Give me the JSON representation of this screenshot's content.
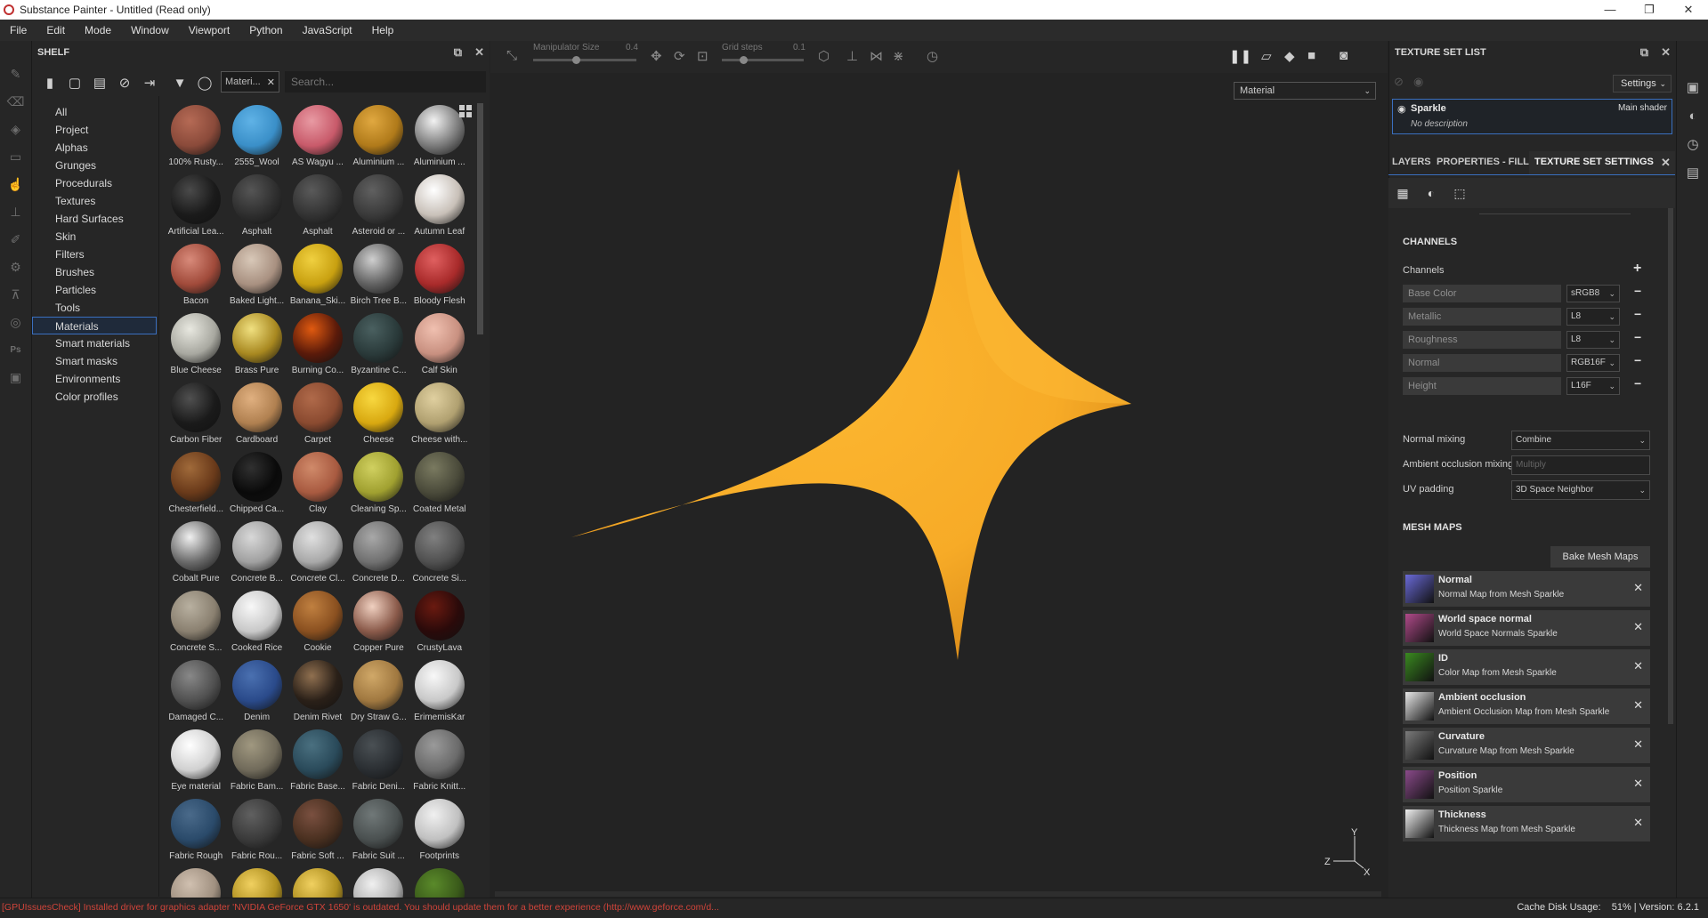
{
  "window": {
    "title": "Substance Painter - Untitled (Read only)",
    "controls": [
      "—",
      "❐",
      "✕"
    ]
  },
  "menu": [
    "File",
    "Edit",
    "Mode",
    "Window",
    "Viewport",
    "Python",
    "JavaScript",
    "Help"
  ],
  "shelf": {
    "title": "SHELF",
    "filter_chip": "Materi...",
    "search_placeholder": "Search...",
    "categories": [
      "All",
      "Project",
      "Alphas",
      "Grunges",
      "Procedurals",
      "Textures",
      "Hard Surfaces",
      "Skin",
      "Filters",
      "Brushes",
      "Particles",
      "Tools",
      "Materials",
      "Smart materials",
      "Smart masks",
      "Environments",
      "Color profiles"
    ],
    "selected_category": "Materials",
    "materials": [
      {
        "name": "100% Rusty...",
        "color": "#8a4a3a",
        "hi": "#b56a55"
      },
      {
        "name": "2555_Wool",
        "color": "#3a8fc8",
        "hi": "#5fb2e6"
      },
      {
        "name": "AS Wagyu ...",
        "color": "#c85a6a",
        "hi": "#e89aa3"
      },
      {
        "name": "Aluminium ...",
        "color": "#b07a1a",
        "hi": "#e0a840"
      },
      {
        "name": "Aluminium ...",
        "color": "#7a7a7a",
        "hi": "#f2f2f2"
      },
      {
        "name": "Artificial Lea...",
        "color": "#1a1a1a",
        "hi": "#4a4a4a"
      },
      {
        "name": "Asphalt",
        "color": "#2e2e2e",
        "hi": "#555555"
      },
      {
        "name": "Asphalt",
        "color": "#333333",
        "hi": "#5a5a5a"
      },
      {
        "name": "Asteroid or ...",
        "color": "#3a3a3a",
        "hi": "#606060"
      },
      {
        "name": "Autumn Leaf",
        "color": "#c8c0b8",
        "hi": "#ffffff"
      },
      {
        "name": "Bacon",
        "color": "#a04a3a",
        "hi": "#d88a7a"
      },
      {
        "name": "Baked Light...",
        "color": "#a89080",
        "hi": "#d8c8b8"
      },
      {
        "name": "Banana_Ski...",
        "color": "#c8a010",
        "hi": "#f0d040"
      },
      {
        "name": "Birch Tree B...",
        "color": "#606060",
        "hi": "#cfcfcf"
      },
      {
        "name": "Bloody Flesh",
        "color": "#a82a2a",
        "hi": "#e06060"
      },
      {
        "name": "Blue Cheese",
        "color": "#a8a8a0",
        "hi": "#e8e8e0"
      },
      {
        "name": "Brass Pure",
        "color": "#a88820",
        "hi": "#f0e080"
      },
      {
        "name": "Burning Co...",
        "color": "#5a1a0a",
        "hi": "#e05a10"
      },
      {
        "name": "Byzantine C...",
        "color": "#2a3a3a",
        "hi": "#4a6060"
      },
      {
        "name": "Calf Skin",
        "color": "#c89080",
        "hi": "#f0c0b0"
      },
      {
        "name": "Carbon Fiber",
        "color": "#1a1a1a",
        "hi": "#505050"
      },
      {
        "name": "Cardboard",
        "color": "#b08050",
        "hi": "#e0b080"
      },
      {
        "name": "Carpet",
        "color": "#8a4a30",
        "hi": "#b06a4a"
      },
      {
        "name": "Cheese",
        "color": "#d8a810",
        "hi": "#f8d840"
      },
      {
        "name": "Cheese with...",
        "color": "#b0a070",
        "hi": "#e0d0a0"
      },
      {
        "name": "Chesterfield...",
        "color": "#6a3a1a",
        "hi": "#a06a3a"
      },
      {
        "name": "Chipped Ca...",
        "color": "#0a0a0a",
        "hi": "#303030"
      },
      {
        "name": "Clay",
        "color": "#a85a40",
        "hi": "#d08a6a"
      },
      {
        "name": "Cleaning Sp...",
        "color": "#a0a030",
        "hi": "#d0d060"
      },
      {
        "name": "Coated Metal",
        "color": "#4a4a3a",
        "hi": "#7a7a60"
      },
      {
        "name": "Cobalt Pure",
        "color": "#6a6a6a",
        "hi": "#f0f0f0"
      },
      {
        "name": "Concrete B...",
        "color": "#a0a0a0",
        "hi": "#d8d8d8"
      },
      {
        "name": "Concrete Cl...",
        "color": "#a8a8a8",
        "hi": "#e0e0e0"
      },
      {
        "name": "Concrete D...",
        "color": "#707070",
        "hi": "#a8a8a8"
      },
      {
        "name": "Concrete Si...",
        "color": "#505050",
        "hi": "#808080"
      },
      {
        "name": "Concrete S...",
        "color": "#8a8070",
        "hi": "#b8b0a0"
      },
      {
        "name": "Cooked Rice",
        "color": "#c8c8c8",
        "hi": "#f8f8f8"
      },
      {
        "name": "Cookie",
        "color": "#8a5020",
        "hi": "#c08040"
      },
      {
        "name": "Copper Pure",
        "color": "#8a5a4a",
        "hi": "#f0d0c0"
      },
      {
        "name": "CrustyLava",
        "color": "#2a0a0a",
        "hi": "#6a1a10"
      },
      {
        "name": "Damaged C...",
        "color": "#505050",
        "hi": "#888888"
      },
      {
        "name": "Denim",
        "color": "#2a4a8a",
        "hi": "#4a70b0"
      },
      {
        "name": "Denim Rivet",
        "color": "#2a2018",
        "hi": "#907050"
      },
      {
        "name": "Dry Straw G...",
        "color": "#a07840",
        "hi": "#d0a868"
      },
      {
        "name": "ErimemisKar",
        "color": "#c8c8c8",
        "hi": "#f8f8f8"
      },
      {
        "name": "Eye material",
        "color": "#d0d0d0",
        "hi": "#ffffff"
      },
      {
        "name": "Fabric Bam...",
        "color": "#706a5a",
        "hi": "#a09880"
      },
      {
        "name": "Fabric Base...",
        "color": "#2a4a5a",
        "hi": "#4a7080"
      },
      {
        "name": "Fabric Deni...",
        "color": "#2a2e32",
        "hi": "#4a5054"
      },
      {
        "name": "Fabric Knitt...",
        "color": "#6a6a6a",
        "hi": "#9a9a9a"
      },
      {
        "name": "Fabric Rough",
        "color": "#2a4a6a",
        "hi": "#4a6a8a"
      },
      {
        "name": "Fabric Rou...",
        "color": "#3a3a3a",
        "hi": "#606060"
      },
      {
        "name": "Fabric Soft ...",
        "color": "#4a3020",
        "hi": "#7a5040"
      },
      {
        "name": "Fabric Suit ...",
        "color": "#4a5050",
        "hi": "#707878"
      },
      {
        "name": "Footprints",
        "color": "#c0c0c0",
        "hi": "#f0f0f0"
      },
      {
        "name": "",
        "color": "#a09080",
        "hi": "#d0c0b0"
      },
      {
        "name": "",
        "color": "#b09020",
        "hi": "#f0d060"
      },
      {
        "name": "",
        "color": "#b09020",
        "hi": "#f0d060"
      },
      {
        "name": "",
        "color": "#b0b0b0",
        "hi": "#f0f0f0"
      },
      {
        "name": "",
        "color": "#3a5a1a",
        "hi": "#5a8a2a"
      }
    ]
  },
  "viewport": {
    "manipulator_label": "Manipulator Size",
    "manipulator_value": "0.4",
    "grid_label": "Grid steps",
    "grid_value": "0.1",
    "material_mode": "Material",
    "object_color": "#f7ae29",
    "axis": {
      "y": "Y",
      "z": "Z",
      "x": "X"
    }
  },
  "texture_set_list": {
    "title": "TEXTURE SET LIST",
    "settings_button": "Settings",
    "item_name": "Sparkle",
    "item_shader": "Main shader",
    "item_desc": "No description"
  },
  "tabs": {
    "layers": "LAYERS",
    "properties": "PROPERTIES - FILL",
    "texture_set_settings": "TEXTURE SET SETTINGS"
  },
  "channels": {
    "header": "CHANNELS",
    "label": "Channels",
    "rows": [
      {
        "name": "Base Color",
        "format": "sRGB8"
      },
      {
        "name": "Metallic",
        "format": "L8"
      },
      {
        "name": "Roughness",
        "format": "L8"
      },
      {
        "name": "Normal",
        "format": "RGB16F"
      },
      {
        "name": "Height",
        "format": "L16F"
      }
    ],
    "normal_mixing_label": "Normal mixing",
    "normal_mixing_value": "Combine",
    "ao_mixing_label": "Ambient occlusion mixing",
    "ao_mixing_value": "Multiply",
    "uv_padding_label": "UV padding",
    "uv_padding_value": "3D Space Neighbor"
  },
  "mesh_maps": {
    "header": "MESH MAPS",
    "bake_button": "Bake Mesh Maps",
    "items": [
      {
        "title": "Normal",
        "subtitle": "Normal Map from Mesh Sparkle",
        "thumb": "#6a6ad8"
      },
      {
        "title": "World space normal",
        "subtitle": "World Space Normals Sparkle",
        "thumb": "#b04a8a"
      },
      {
        "title": "ID",
        "subtitle": "Color Map from Mesh Sparkle",
        "thumb": "#3a8a20"
      },
      {
        "title": "Ambient occlusion",
        "subtitle": "Ambient Occlusion Map from Mesh Sparkle",
        "thumb": "#e8e8e8"
      },
      {
        "title": "Curvature",
        "subtitle": "Curvature Map from Mesh Sparkle",
        "thumb": "#7a7a7a"
      },
      {
        "title": "Position",
        "subtitle": "Position Sparkle",
        "thumb": "#8a4a8a"
      },
      {
        "title": "Thickness",
        "subtitle": "Thickness Map from Mesh Sparkle",
        "thumb": "#f0f0f0"
      }
    ]
  },
  "status": {
    "message": "[GPUIssuesCheck] Installed driver for graphics adapter 'NVIDIA GeForce GTX 1650' is outdated. You should update them for a better experience (http://www.geforce.com/d...",
    "right": "Cache Disk Usage:    51% | Version: 6.2.1"
  }
}
